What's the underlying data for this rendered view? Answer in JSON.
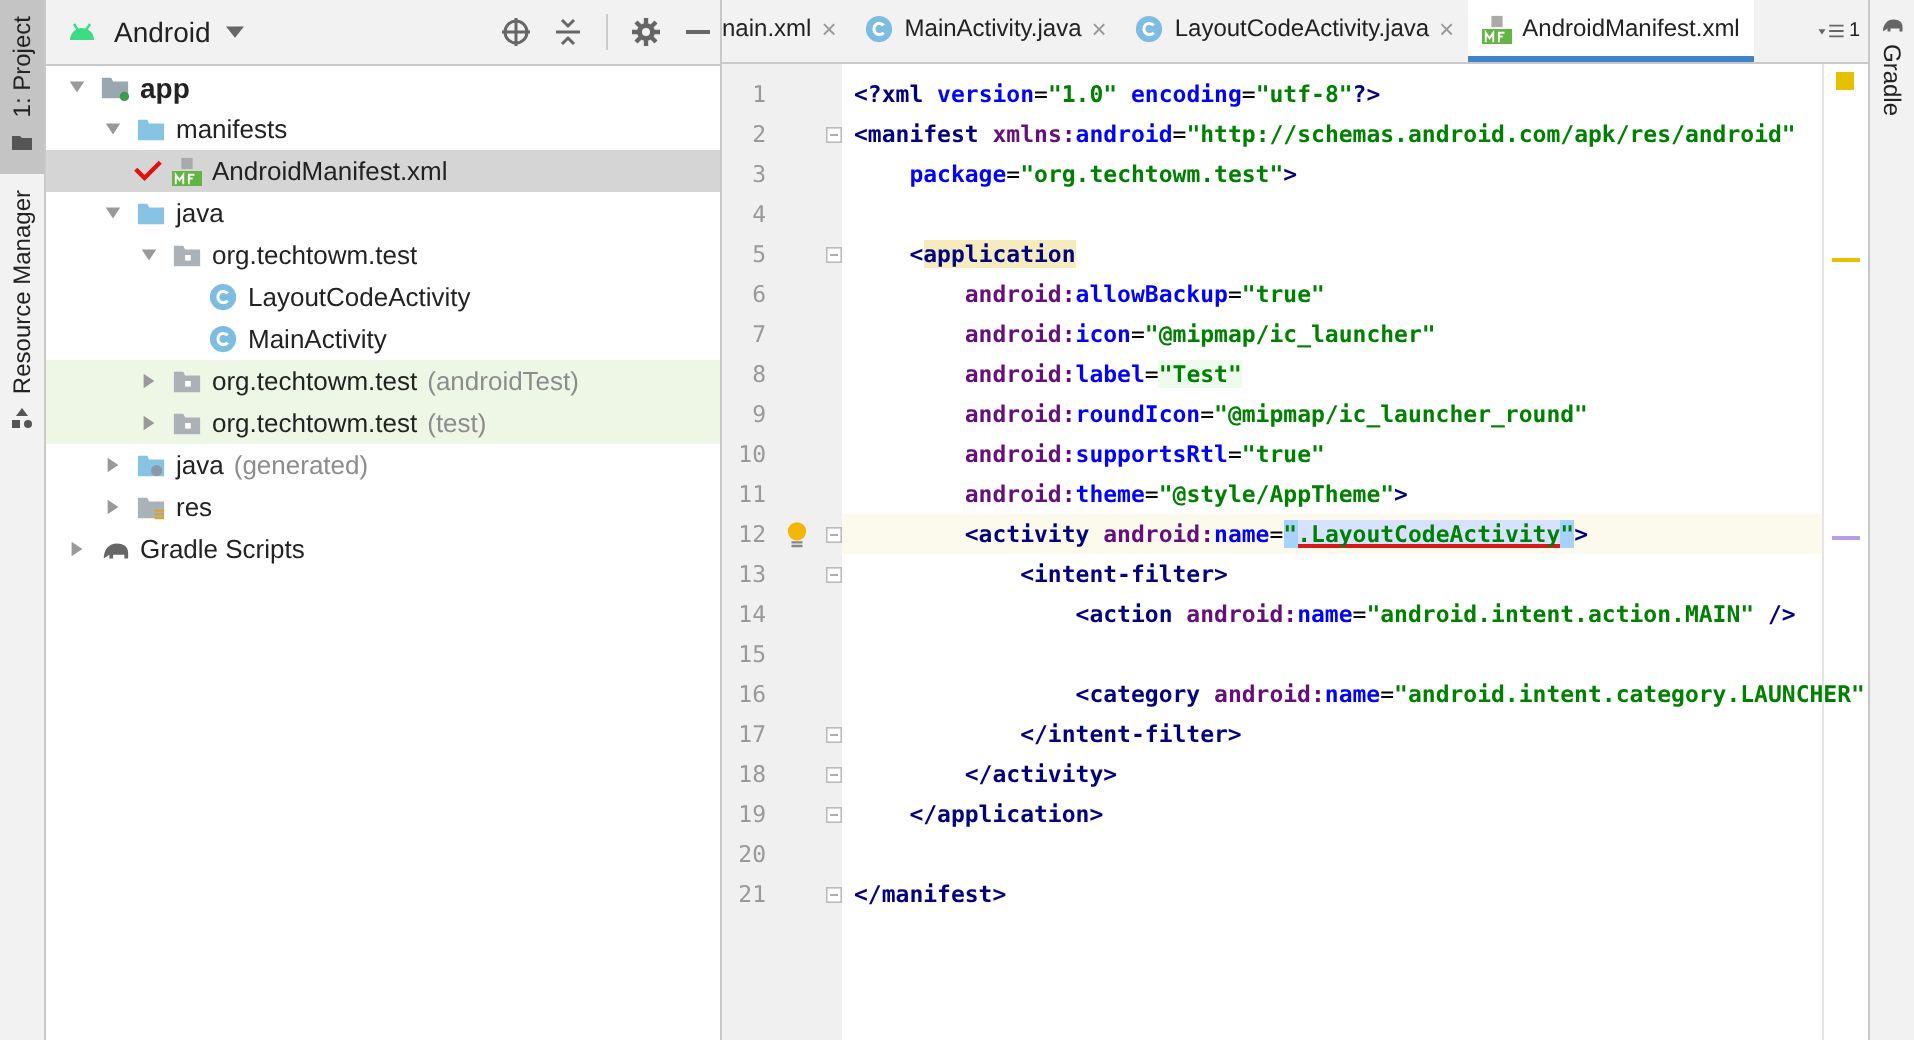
{
  "tool_strip": [
    {
      "label": "1: Project",
      "selected": true,
      "kind": "folder"
    },
    {
      "label": "Resource Manager",
      "selected": false,
      "kind": "shapes"
    }
  ],
  "project": {
    "view": "Android",
    "tree": [
      {
        "label": "app",
        "kind": "module",
        "bold": true,
        "expanded": true,
        "selected": false,
        "highlighted": false,
        "children": [
          {
            "label": "manifests",
            "kind": "folder",
            "expanded": true,
            "selected": false,
            "highlighted": false,
            "children": [
              {
                "label": "AndroidManifest.xml",
                "kind": "manifest",
                "selected": true,
                "highlighted": false,
                "marked": true
              }
            ]
          },
          {
            "label": "java",
            "kind": "folder",
            "expanded": true,
            "selected": false,
            "highlighted": false,
            "children": [
              {
                "label": "org.techtowm.test",
                "kind": "package",
                "expanded": true,
                "selected": false,
                "highlighted": false,
                "children": [
                  {
                    "label": "LayoutCodeActivity",
                    "kind": "class",
                    "selected": false,
                    "highlighted": false
                  },
                  {
                    "label": "MainActivity",
                    "kind": "class",
                    "selected": false,
                    "highlighted": false
                  }
                ]
              },
              {
                "label": "org.techtowm.test",
                "suffix": "(androidTest)",
                "kind": "package",
                "expanded": false,
                "selected": false,
                "highlighted": true
              },
              {
                "label": "org.techtowm.test",
                "suffix": "(test)",
                "kind": "package",
                "expanded": false,
                "selected": false,
                "highlighted": true
              }
            ]
          },
          {
            "label": "java",
            "suffix": "(generated)",
            "kind": "generated",
            "expanded": false,
            "selected": false,
            "highlighted": false
          },
          {
            "label": "res",
            "kind": "res",
            "expanded": false,
            "selected": false,
            "highlighted": false
          }
        ]
      },
      {
        "label": "Gradle Scripts",
        "kind": "gradle",
        "expanded": false,
        "selected": false,
        "highlighted": false
      }
    ]
  },
  "tabs": [
    {
      "label": "nain.xml",
      "kind": "plain",
      "close": "×",
      "selected": false
    },
    {
      "label": "MainActivity.java",
      "kind": "class",
      "close": "×",
      "selected": false
    },
    {
      "label": "LayoutCodeActivity.java",
      "kind": "class",
      "close": "×",
      "selected": false
    },
    {
      "label": "AndroidManifest.xml",
      "kind": "manifest",
      "selected": true
    }
  ],
  "tab_count": "1",
  "right_strip": {
    "label": "Gradle"
  },
  "editor": {
    "lines": [
      {
        "number": "1",
        "fold": false,
        "current": false,
        "bulb": false,
        "tokens": [
          {
            "kind": "tag",
            "text": "<?xml "
          },
          {
            "kind": "attr",
            "text": "version"
          },
          {
            "kind": "plain",
            "text": "="
          },
          {
            "kind": "str",
            "text": "\"1.0\" "
          },
          {
            "kind": "attr",
            "text": "encoding"
          },
          {
            "kind": "plain",
            "text": "="
          },
          {
            "kind": "str",
            "text": "\"utf-8\""
          },
          {
            "kind": "tag",
            "text": "?>"
          }
        ]
      },
      {
        "number": "2",
        "fold": true,
        "current": false,
        "bulb": false,
        "tokens": [
          {
            "kind": "tag",
            "text": "<manifest "
          },
          {
            "kind": "ns",
            "text": "xmlns:"
          },
          {
            "kind": "attr",
            "text": "android"
          },
          {
            "kind": "plain",
            "text": "="
          },
          {
            "kind": "str",
            "text": "\"http://schemas.android.com/apk/res/android\""
          }
        ]
      },
      {
        "number": "3",
        "fold": false,
        "current": false,
        "bulb": false,
        "tokens": [
          {
            "kind": "attr",
            "text": "    package"
          },
          {
            "kind": "plain",
            "text": "="
          },
          {
            "kind": "str",
            "text": "\"org.techtowm.test\""
          },
          {
            "kind": "tag",
            "text": ">"
          }
        ]
      },
      {
        "number": "4",
        "fold": false,
        "current": false,
        "bulb": false
      },
      {
        "number": "5",
        "fold": true,
        "current": false,
        "bulb": false,
        "tokens": [
          {
            "kind": "tag",
            "text": "    <"
          },
          {
            "kind": "taghl",
            "text": "application"
          }
        ]
      },
      {
        "number": "6",
        "fold": false,
        "current": false,
        "bulb": false,
        "tokens": [
          {
            "kind": "ns",
            "text": "        android:"
          },
          {
            "kind": "attr",
            "text": "allowBackup"
          },
          {
            "kind": "plain",
            "text": "="
          },
          {
            "kind": "str",
            "text": "\"true\""
          }
        ]
      },
      {
        "number": "7",
        "fold": false,
        "current": false,
        "bulb": false,
        "tokens": [
          {
            "kind": "ns",
            "text": "        android:"
          },
          {
            "kind": "attr",
            "text": "icon"
          },
          {
            "kind": "plain",
            "text": "="
          },
          {
            "kind": "str",
            "text": "\"@mipmap/ic_launcher\""
          }
        ]
      },
      {
        "number": "8",
        "fold": false,
        "current": false,
        "bulb": false,
        "tokens": [
          {
            "kind": "ns",
            "text": "        android:"
          },
          {
            "kind": "attr",
            "text": "label"
          },
          {
            "kind": "plain",
            "text": "="
          },
          {
            "kind": "strhl",
            "text": "\"Test\""
          }
        ]
      },
      {
        "number": "9",
        "fold": false,
        "current": false,
        "bulb": false,
        "tokens": [
          {
            "kind": "ns",
            "text": "        android:"
          },
          {
            "kind": "attr",
            "text": "roundIcon"
          },
          {
            "kind": "plain",
            "text": "="
          },
          {
            "kind": "str",
            "text": "\"@mipmap/ic_launcher_round\""
          }
        ]
      },
      {
        "number": "10",
        "fold": false,
        "current": false,
        "bulb": false,
        "tokens": [
          {
            "kind": "ns",
            "text": "        android:"
          },
          {
            "kind": "attr",
            "text": "supportsRtl"
          },
          {
            "kind": "plain",
            "text": "="
          },
          {
            "kind": "str",
            "text": "\"true\""
          }
        ]
      },
      {
        "number": "11",
        "fold": false,
        "current": false,
        "bulb": false,
        "tokens": [
          {
            "kind": "ns",
            "text": "        android:"
          },
          {
            "kind": "attr",
            "text": "theme"
          },
          {
            "kind": "plain",
            "text": "="
          },
          {
            "kind": "str",
            "text": "\"@style/AppTheme\""
          },
          {
            "kind": "tag",
            "text": ">"
          }
        ]
      },
      {
        "number": "12",
        "fold": true,
        "current": true,
        "bulb": true,
        "tokens": [
          {
            "kind": "tag",
            "text": "        <activity "
          },
          {
            "kind": "ns",
            "text": "android:"
          },
          {
            "kind": "attr",
            "text": "name"
          },
          {
            "kind": "plain",
            "text": "="
          },
          {
            "kind": "strsel",
            "text": "\""
          },
          {
            "kind": "strmark",
            "text": ".LayoutCodeActivity"
          },
          {
            "kind": "strsel",
            "text": "\""
          },
          {
            "kind": "tag",
            "text": ">"
          }
        ]
      },
      {
        "number": "13",
        "fold": true,
        "current": false,
        "bulb": false,
        "tokens": [
          {
            "kind": "tag",
            "text": "            <intent-filter>"
          }
        ]
      },
      {
        "number": "14",
        "fold": false,
        "current": false,
        "bulb": false,
        "tokens": [
          {
            "kind": "tag",
            "text": "                <action "
          },
          {
            "kind": "ns",
            "text": "android:"
          },
          {
            "kind": "attr",
            "text": "name"
          },
          {
            "kind": "plain",
            "text": "="
          },
          {
            "kind": "str",
            "text": "\"android.intent.action.MAIN\" "
          },
          {
            "kind": "tag",
            "text": "/>"
          }
        ]
      },
      {
        "number": "15",
        "fold": false,
        "current": false,
        "bulb": false
      },
      {
        "number": "16",
        "fold": false,
        "current": false,
        "bulb": false,
        "tokens": [
          {
            "kind": "tag",
            "text": "                <category "
          },
          {
            "kind": "ns",
            "text": "android:"
          },
          {
            "kind": "attr",
            "text": "name"
          },
          {
            "kind": "plain",
            "text": "="
          },
          {
            "kind": "str",
            "text": "\"android.intent.category.LAUNCHER\""
          }
        ]
      },
      {
        "number": "17",
        "fold": true,
        "current": false,
        "bulb": false,
        "tokens": [
          {
            "kind": "tag",
            "text": "            </intent-filter>"
          }
        ]
      },
      {
        "number": "18",
        "fold": true,
        "current": false,
        "bulb": false,
        "tokens": [
          {
            "kind": "tag",
            "text": "        </activity>"
          }
        ]
      },
      {
        "number": "19",
        "fold": true,
        "current": false,
        "bulb": false,
        "tokens": [
          {
            "kind": "tag",
            "text": "    </application>"
          }
        ]
      },
      {
        "number": "20",
        "fold": false,
        "current": false,
        "bulb": false
      },
      {
        "number": "21",
        "fold": true,
        "current": false,
        "bulb": false,
        "tokens": [
          {
            "kind": "tag",
            "text": "</manifest>"
          }
        ]
      }
    ]
  }
}
